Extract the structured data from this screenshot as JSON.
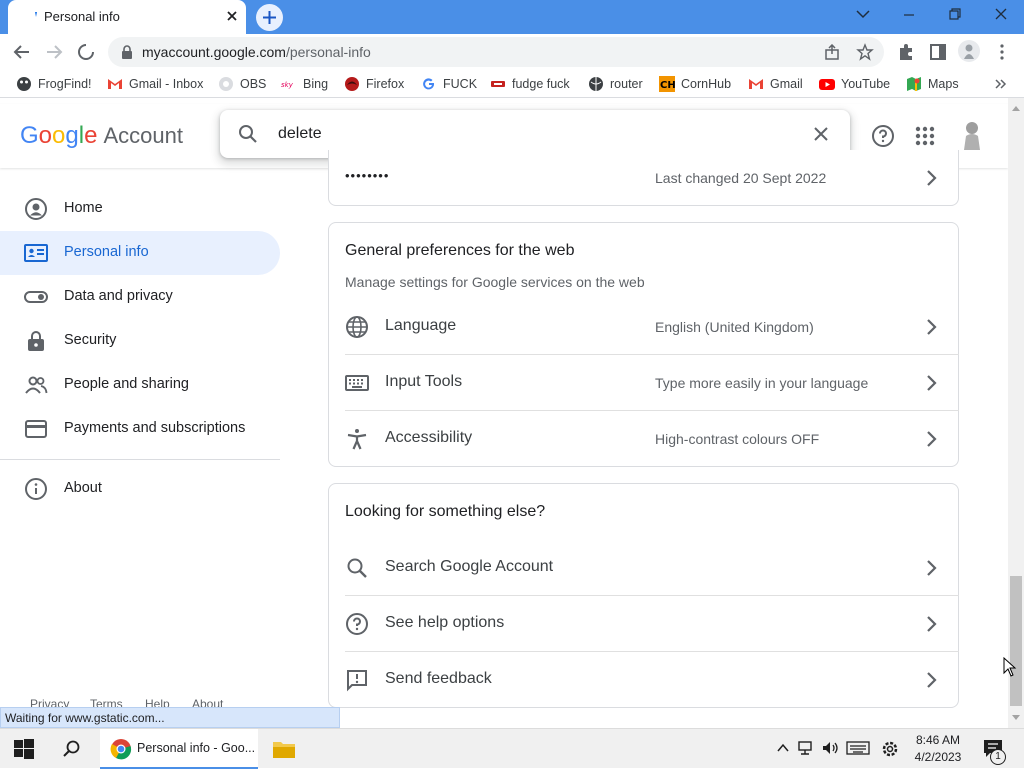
{
  "browser": {
    "tab_title": "Personal info",
    "url_host": "myaccount.google.com",
    "url_path": "/personal-info",
    "bookmarks": [
      {
        "label": "FrogFind!",
        "icon": "frog-icon"
      },
      {
        "label": "Gmail - Inbox",
        "icon": "gmail-icon"
      },
      {
        "label": "OBS",
        "icon": "obs-icon"
      },
      {
        "label": "Bing",
        "icon": "sky-icon"
      },
      {
        "label": "Firefox",
        "icon": "firefox-icon"
      },
      {
        "label": "FUCK",
        "icon": "google-g-icon"
      },
      {
        "label": "fudge fuck",
        "icon": "link-icon"
      },
      {
        "label": "router",
        "icon": "globe-icon"
      },
      {
        "label": "CornHub",
        "icon": "ch-icon"
      },
      {
        "label": "Gmail",
        "icon": "gmail-icon"
      },
      {
        "label": "YouTube",
        "icon": "youtube-icon"
      },
      {
        "label": "Maps",
        "icon": "maps-icon"
      }
    ],
    "status_text": "Waiting for www.gstatic.com..."
  },
  "header": {
    "logo_google": "Google",
    "logo_account": "Account",
    "search_query": "delete"
  },
  "sidebar": {
    "items": [
      {
        "label": "Home",
        "icon": "account-circle-icon"
      },
      {
        "label": "Personal info",
        "icon": "id-card-icon"
      },
      {
        "label": "Data and privacy",
        "icon": "toggle-icon"
      },
      {
        "label": "Security",
        "icon": "lock-icon"
      },
      {
        "label": "People and sharing",
        "icon": "people-icon"
      },
      {
        "label": "Payments and subscriptions",
        "icon": "credit-card-icon"
      },
      {
        "label": "About",
        "icon": "info-icon"
      }
    ],
    "footer": [
      "Privacy",
      "Terms",
      "Help",
      "About"
    ]
  },
  "password_row": {
    "masked": "••••••••",
    "value": "Last changed 20 Sept 2022"
  },
  "prefs_card": {
    "title": "General preferences for the web",
    "subtitle": "Manage settings for Google services on the web",
    "rows": [
      {
        "label": "Language",
        "value": "English (United Kingdom)",
        "icon": "globe-icon"
      },
      {
        "label": "Input Tools",
        "value": "Type more easily in your language",
        "icon": "keyboard-icon"
      },
      {
        "label": "Accessibility",
        "value": "High-contrast colours OFF",
        "icon": "accessibility-icon"
      }
    ]
  },
  "else_card": {
    "title": "Looking for something else?",
    "rows": [
      {
        "label": "Search Google Account",
        "icon": "search-icon"
      },
      {
        "label": "See help options",
        "icon": "help-icon"
      },
      {
        "label": "Send feedback",
        "icon": "feedback-icon"
      }
    ]
  },
  "taskbar": {
    "chrome_label": "Personal info - Goo...",
    "time": "8:46 AM",
    "date": "4/2/2023",
    "notification_count": "1"
  },
  "colors": {
    "tabstrip": "#4a8fe7",
    "active_nav_bg": "#e8f0fe",
    "active_nav_text": "#1967d2"
  }
}
